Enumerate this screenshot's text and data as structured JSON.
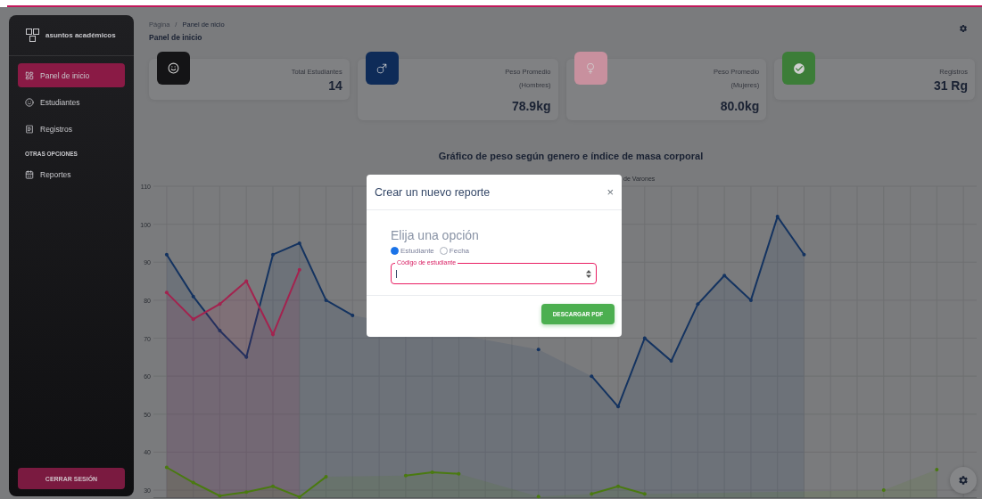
{
  "sidebar": {
    "brand": "asuntos académicos",
    "items": [
      {
        "label": "Panel de inicio",
        "selected": true
      },
      {
        "label": "Estudiantes",
        "selected": false
      },
      {
        "label": "Registros",
        "selected": false
      }
    ],
    "section_label": "OTRAS OPCIONES",
    "section_items": [
      {
        "label": "Reportes",
        "selected": false
      }
    ],
    "logout": "CERRAR SESIÓN"
  },
  "header": {
    "breadcrumb": [
      "Página",
      "Panel de nicio"
    ],
    "separator": "/",
    "title": "Panel de inicio"
  },
  "cards": [
    {
      "label": "Total Estudiantes",
      "value": "14",
      "color": "#141416"
    },
    {
      "label": "Peso Promedio (Hombres)",
      "value": "78.9kg",
      "color": "#0e2b58"
    },
    {
      "label": "Peso Promedio (Mujeres)",
      "value": "80.0kg",
      "color": "#c8909e"
    },
    {
      "label": "Registros",
      "value": "31 Rg",
      "color": "#3c7d38"
    }
  ],
  "chart": {
    "title": "Gráfico de peso según genero e índice de masa corporal",
    "chart_data": {
      "type": "area",
      "grid": true,
      "ylim": [
        28,
        110
      ],
      "yticks": [
        30,
        40,
        50,
        60,
        70,
        80,
        90,
        100,
        110
      ],
      "series": [
        {
          "name": "de Varones",
          "color": "#143360",
          "values": [
            92,
            81,
            72,
            65,
            92,
            95,
            80,
            76,
            null,
            null,
            null,
            null,
            null,
            null,
            67,
            null,
            60,
            52,
            70,
            64,
            79,
            86.5,
            80,
            102,
            92,
            null,
            null,
            null,
            null,
            null,
            null
          ]
        },
        {
          "color": "#a3234f",
          "values": [
            82,
            75,
            79,
            85,
            71,
            88,
            null,
            null,
            null,
            null,
            null,
            null,
            null,
            null,
            null,
            null,
            null,
            null,
            null,
            null,
            null,
            null,
            null,
            null,
            null,
            null,
            null,
            null,
            null,
            null,
            null
          ]
        },
        {
          "color": "#4a7a10",
          "values": [
            36,
            32,
            28.5,
            29.5,
            31,
            28.2,
            33.5,
            null,
            null,
            33.8,
            34.7,
            34.3,
            null,
            null,
            28.3,
            null,
            29,
            31,
            29,
            null,
            null,
            null,
            null,
            null,
            null,
            null,
            null,
            30,
            null,
            35.4,
            null
          ]
        }
      ]
    }
  },
  "modal": {
    "title": "Crear un nuevo reporte",
    "close": "×",
    "heading": "Elija una opción",
    "options": [
      {
        "label": "Estudiante",
        "selected": true
      },
      {
        "label": "Fecha",
        "selected": false
      }
    ],
    "field": {
      "label": "Código de estudiante",
      "focused": true
    },
    "button": "DESCARGAR PDF"
  }
}
